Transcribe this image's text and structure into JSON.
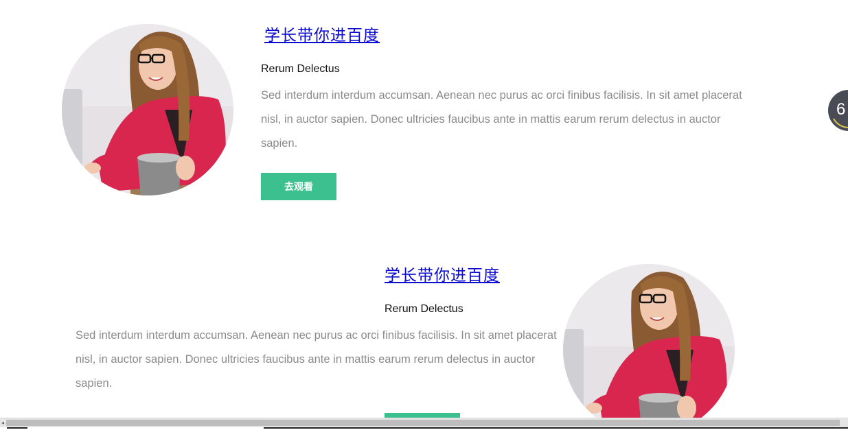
{
  "colors": {
    "link": "#0a0ad0",
    "button_bg": "#3cc08f",
    "body_text": "#8a8a8a",
    "widget_bg": "#4a4c55"
  },
  "cards": [
    {
      "title": "学长带你进百度",
      "subtitle": "Rerum Delectus",
      "body": "Sed interdum interdum accumsan. Aenean nec purus ac orci finibus facilisis. In sit amet placerat nisl, in auctor sapien. Donec ultricies faucibus ante in mattis earum rerum delectus in auctor sapien.",
      "button_label": "去观看",
      "image": "woman-with-laptop-and-coffee-mug"
    },
    {
      "title": "学长带你进百度",
      "subtitle": "Rerum Delectus",
      "body": "Sed interdum interdum accumsan. Aenean nec purus ac orci finibus facilisis. In sit amet placerat nisl, in auctor sapien. Donec ultricies faucibus ante in mattis earum rerum delectus in auctor sapien.",
      "button_label": "",
      "image": "woman-with-laptop-and-coffee-mug"
    }
  ],
  "side_widget": {
    "value": "6"
  },
  "scrollbar": {
    "left_arrow": "◂",
    "thumb_fraction": 0.99
  }
}
